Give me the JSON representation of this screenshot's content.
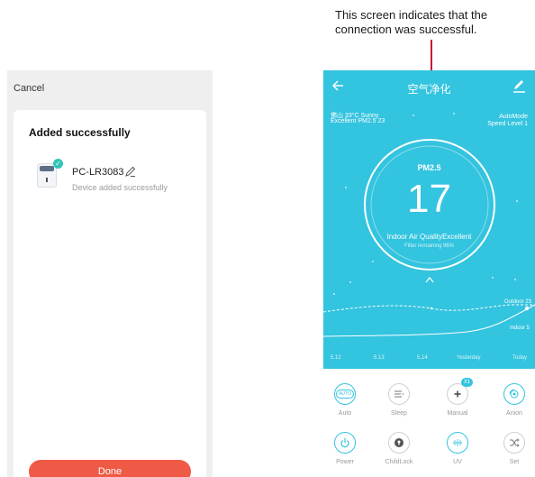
{
  "left_screen": {
    "cancel_label": "Cancel",
    "card_title": "Added successfully",
    "device_name": "PC-LR3083",
    "device_status": "Device added successfully",
    "done_label": "Done"
  },
  "annotation": {
    "text": "This screen indicates that the connection was successful."
  },
  "right_screen": {
    "title": "空气净化",
    "weather_line1": "佛山 33°C Sunny",
    "weather_line2": "Excellent PM2.5 23",
    "mode_line1": "AutoMode",
    "mode_line2": "Speed Level 1",
    "pm_label": "PM2.5",
    "pm_value": "17",
    "quality_text": "Indoor Air QualityExcellent",
    "filter_text": "Filter remaining 96%",
    "outdoor_label": "Outdoor 23",
    "indoor_label": "Indoor 5",
    "dates": [
      "5.12",
      "5.13",
      "5.14",
      "Yesterday",
      "Today"
    ],
    "controls": [
      {
        "label": "Auto",
        "icon": "auto-icon"
      },
      {
        "label": "Sleep",
        "icon": "sleep-icon"
      },
      {
        "label": "Manual",
        "icon": "fan-icon",
        "badge": "X1"
      },
      {
        "label": "Anion",
        "icon": "anion-icon"
      },
      {
        "label": "Power",
        "icon": "power-icon"
      },
      {
        "label": "ChildLock",
        "icon": "lock-icon"
      },
      {
        "label": "UV",
        "icon": "uv-icon"
      },
      {
        "label": "Set",
        "icon": "shuffle-icon"
      }
    ]
  },
  "colors": {
    "accent_teal": "#33c4df",
    "done_red": "#ee5a45",
    "annotation_line": "#c4122f"
  }
}
